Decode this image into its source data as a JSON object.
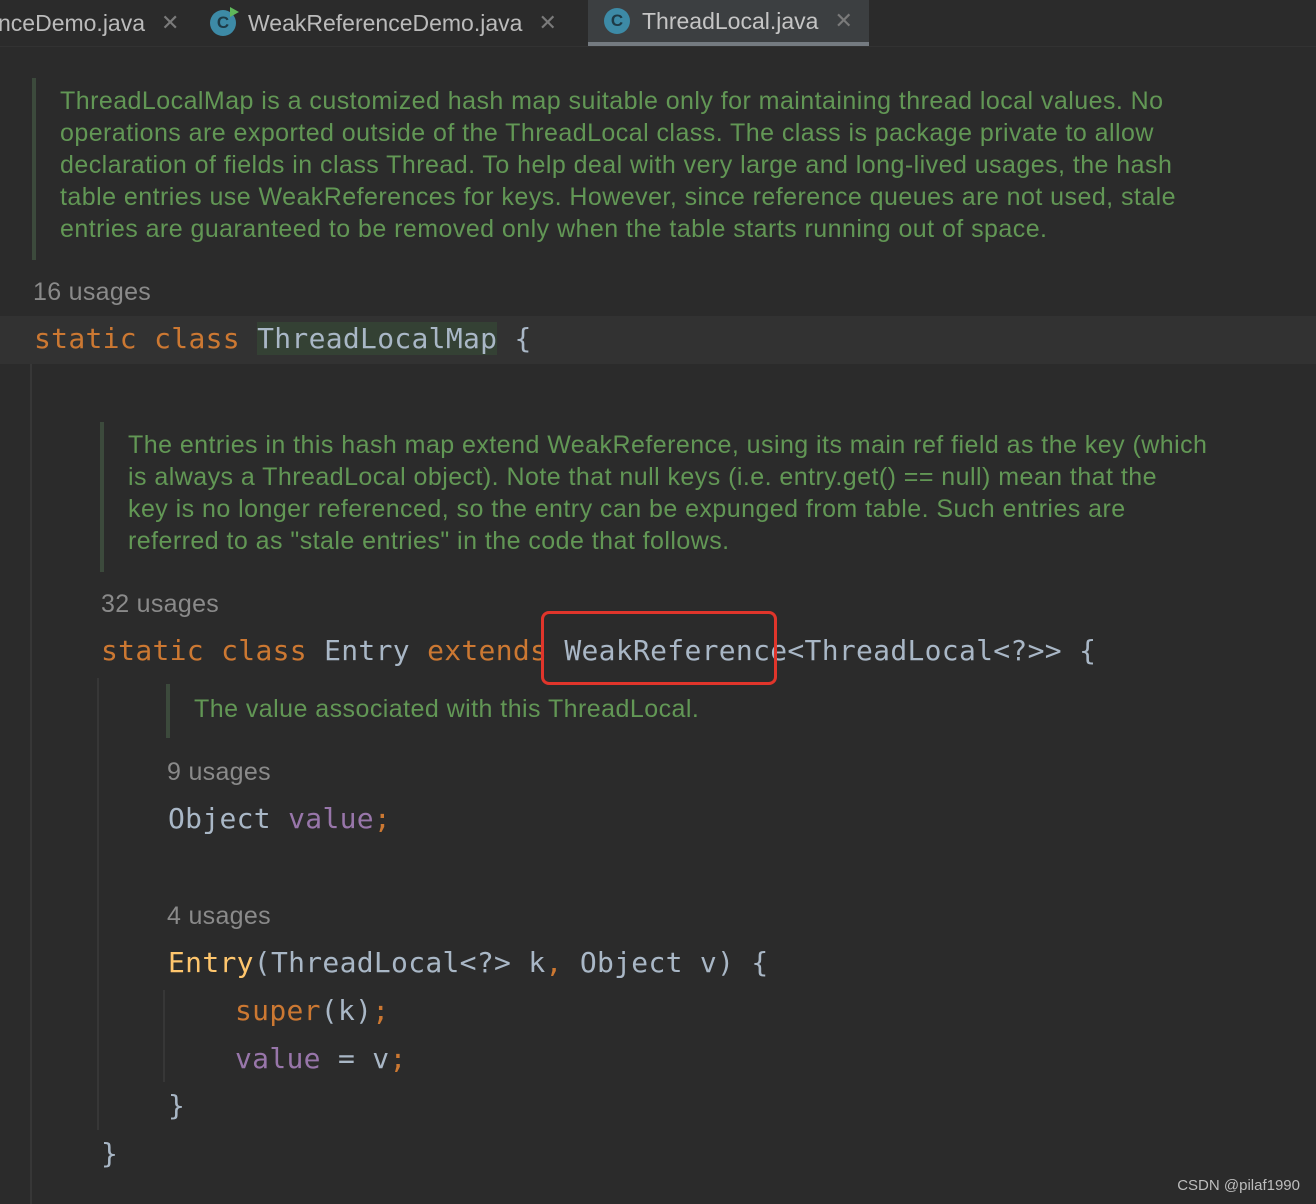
{
  "tabs": [
    {
      "label": "nceDemo.java",
      "active": false
    },
    {
      "label": "WeakReferenceDemo.java",
      "active": false,
      "icon": "class-run-icon"
    },
    {
      "label": "ThreadLocal.java",
      "active": true,
      "icon": "class-icon"
    }
  ],
  "tab_close_glyph": "✕",
  "class_icon_letter": "C",
  "doc1": "ThreadLocalMap is a customized hash map suitable only for maintaining thread local values. No\noperations are exported outside of the ThreadLocal class. The class is package private to allow\ndeclaration of fields in class Thread. To help deal with very large and long-lived usages, the hash\ntable entries use WeakReferences for keys. However, since reference queues are not used, stale\nentries are guaranteed to be removed only when the table starts running out of space.",
  "usages1": "16 usages",
  "line1": {
    "kw1": "static",
    "kw2": "class",
    "name": "ThreadLocalMap",
    "rest": " {"
  },
  "doc2": "The entries in this hash map extend WeakReference, using its main ref field as the key (which\nis always a ThreadLocal object). Note that null keys (i.e. entry.get() == null) mean that the\nkey is no longer referenced, so the entry can be expunged from table. Such entries are\nreferred to as \"stale entries\" in the code that follows.",
  "usages2": "32 usages",
  "line2": {
    "kw1": "static",
    "kw2": "class",
    "name": "Entry",
    "kw3": "extends",
    "type": "WeakReference",
    "rest": "<ThreadLocal<?>> {"
  },
  "doc3": "The value associated with this ThreadLocal.",
  "usages3": "9 usages",
  "line3": {
    "type": "Object",
    "field": "value",
    "semi": ";"
  },
  "usages4": "4 usages",
  "line4": {
    "fn": "Entry",
    "open": "(ThreadLocal<?> k",
    "comma": ",",
    "rest": " Object v) {"
  },
  "line5": {
    "kw": "super",
    "args": "(k)",
    "semi": ";"
  },
  "line6": {
    "field": "value",
    "rest": " = v",
    "semi": ";"
  },
  "line7": "}",
  "line8": "}",
  "watermark": "CSDN @pilaf1990",
  "colors": {
    "keyword": "#cc7832",
    "field": "#9876aa",
    "method": "#ffc66d",
    "doc": "#629755",
    "highlight_box": "#e0352b"
  }
}
